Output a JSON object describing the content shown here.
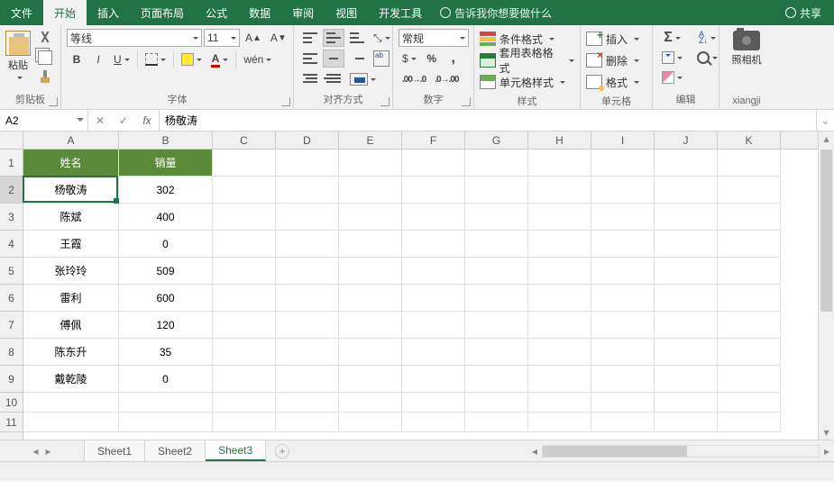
{
  "tabs": {
    "file": "文件",
    "home": "开始",
    "insert": "插入",
    "layout": "页面布局",
    "formula": "公式",
    "data": "数据",
    "review": "审阅",
    "view": "视图",
    "dev": "开发工具",
    "tellme": "告诉我你想要做什么",
    "share": "共享"
  },
  "groups": {
    "clipboard": "剪贴板",
    "font": "字体",
    "align": "对齐方式",
    "number": "数字",
    "styles": "样式",
    "cells": "单元格",
    "editing": "编辑",
    "camera": "xiangji"
  },
  "clipboard": {
    "paste": "粘贴"
  },
  "font": {
    "family": "等线",
    "size": "11",
    "wen": "wén"
  },
  "number": {
    "format": "常规"
  },
  "styles": {
    "cond": "条件格式",
    "table": "套用表格格式",
    "cell": "单元格样式"
  },
  "cellsg": {
    "insert": "插入",
    "delete": "删除",
    "format": "格式"
  },
  "camera": {
    "label": "照相机"
  },
  "namebox": "A2",
  "formula_value": "杨敬涛",
  "col_letters": [
    "A",
    "B",
    "C",
    "D",
    "E",
    "F",
    "G",
    "H",
    "I",
    "J",
    "K"
  ],
  "row_nums": [
    "1",
    "2",
    "3",
    "4",
    "5",
    "6",
    "7",
    "8",
    "9",
    "10",
    "11"
  ],
  "header": {
    "a": "姓名",
    "b": "销量"
  },
  "rows": [
    {
      "a": "杨敬涛",
      "b": "302"
    },
    {
      "a": "陈斌",
      "b": "400"
    },
    {
      "a": "王霞",
      "b": "0"
    },
    {
      "a": "张玲玲",
      "b": "509"
    },
    {
      "a": "雷利",
      "b": "600"
    },
    {
      "a": "傅佩",
      "b": "120"
    },
    {
      "a": "陈东升",
      "b": "35"
    },
    {
      "a": "戴乾陵",
      "b": "0"
    }
  ],
  "sheets": {
    "s1": "Sheet1",
    "s2": "Sheet2",
    "s3": "Sheet3"
  },
  "colors": {
    "accent": "#217346",
    "header_bg": "#5b8a3a"
  }
}
